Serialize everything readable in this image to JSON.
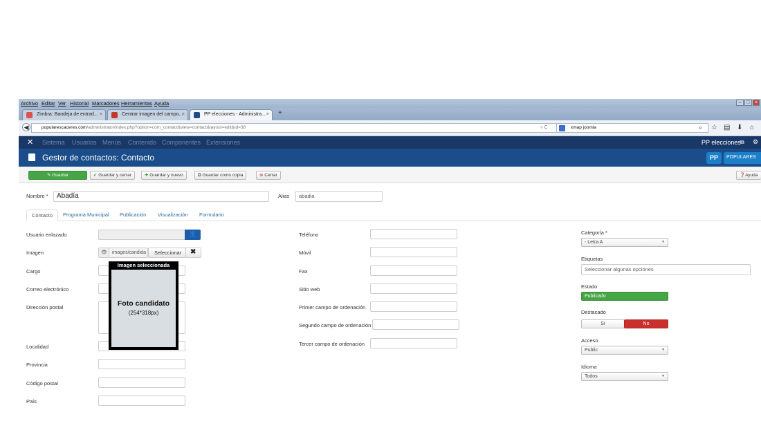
{
  "browser": {
    "menu": [
      "Archivo",
      "Editar",
      "Ver",
      "Historial",
      "Marcadores",
      "Herramientas",
      "Ayuda"
    ],
    "tabs": [
      {
        "title": "Zimbra: Bandeja de entrad..."
      },
      {
        "title": "Centrar imagen del campo..."
      },
      {
        "title": "PP elecciones - Administra..."
      }
    ],
    "new_tab": "+",
    "url_host": "popularescaceres.com",
    "url_path": "/administrator/index.php?option=com_contact&view=contact&layout=edit&id=38",
    "search_text": "xmap joomla"
  },
  "admin": {
    "menu": [
      "Sistema",
      "Usuarios",
      "Menús",
      "Contenido",
      "Componentes",
      "Extensiones"
    ],
    "site_name": "PP elecciones",
    "page_title": "Gestor de contactos: Contacto",
    "logo_text": "POPULARES"
  },
  "toolbar": {
    "save": "Guardar",
    "save_close": "Guardar y cerrar",
    "save_new": "Guardar y nuevo",
    "save_copy": "Guardar como copia",
    "close": "Cerrar",
    "help": "Ayuda"
  },
  "form": {
    "name_label": "Nombre *",
    "name_value": "Abadía",
    "alias_label": "Alias",
    "alias_value": "abadia",
    "tabs": [
      "Contacto",
      "Programa Municipal",
      "Publicación",
      "Visualización",
      "Formulario"
    ],
    "left_labels": {
      "user": "Usuario enlazado",
      "image": "Imagen",
      "position": "Cargo",
      "email": "Correo electrónico",
      "address": "Dirección postal",
      "city": "Localidad",
      "province": "Provincia",
      "postcode": "Código postal",
      "country": "País"
    },
    "image_path": "images/candida",
    "image_select": "Seleccionar",
    "middle_labels": {
      "phone": "Teléfono",
      "mobile": "Móvil",
      "fax": "Fax",
      "website": "Sitio web",
      "sort1": "Primer campo de ordenación",
      "sort2": "Segundo campo de ordenación",
      "sort3": "Tercer campo de ordenación"
    },
    "right": {
      "category_label": "Categoría *",
      "category_value": "- Letra A",
      "tags_label": "Etiquetas",
      "tags_placeholder": "Seleccionar algunas opciones",
      "status_label": "Estado",
      "status_value": "Publicado",
      "featured_label": "Destacado",
      "featured_yes": "Sí",
      "featured_no": "No",
      "access_label": "Acceso",
      "access_value": "Public",
      "language_label": "Idioma",
      "language_value": "Todos"
    }
  },
  "overlay": {
    "header": "Imagen seleccionada",
    "title": "Foto candidato",
    "size": "(254*318px)"
  },
  "colors": {
    "admin_bar": "#1a3867",
    "header": "#1b4d8b",
    "save_green": "#46a546",
    "status_green": "#46a546",
    "no_red": "#c9302c"
  }
}
